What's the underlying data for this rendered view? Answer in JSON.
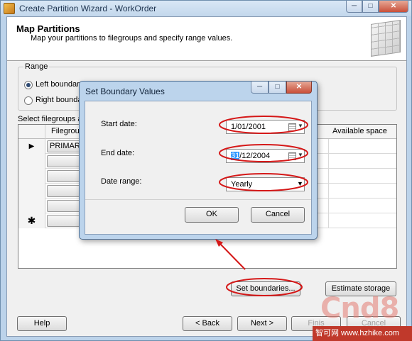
{
  "window": {
    "title": "Create Partition Wizard - WorkOrder",
    "controls": {
      "minimize": "─",
      "maximize": "□",
      "close": "✕"
    }
  },
  "header": {
    "title": "Map Partitions",
    "subtitle": "Map your partitions to filegroups and specify range values."
  },
  "range": {
    "legend": "Range",
    "left_label": "Left boundary",
    "right_label": "Right boundar",
    "selected": "left"
  },
  "grid": {
    "label": "Select filegroups ar",
    "columns": {
      "filegroup": "Filegroup",
      "available_space": "Available space"
    },
    "rows": [
      {
        "selector": "▶",
        "filegroup": "PRIMARY"
      },
      {
        "selector": "",
        "filegroup": ""
      },
      {
        "selector": "",
        "filegroup": ""
      },
      {
        "selector": "",
        "filegroup": ""
      },
      {
        "selector": "",
        "filegroup": ""
      },
      {
        "selector": "✱",
        "filegroup": ""
      }
    ]
  },
  "buttons": {
    "set_boundaries": "Set boundaries...",
    "estimate_storage": "Estimate storage",
    "help": "Help",
    "back": "< Back",
    "next": "Next >",
    "finish": "Finis",
    "cancel": "Cancel"
  },
  "dialog": {
    "title": "Set Boundary Values",
    "start_date_label": "Start date:",
    "start_date_value": "1/01/2001",
    "end_date_label": "End date:",
    "end_date_selected": "31",
    "end_date_rest": "/12/2004",
    "date_range_label": "Date range:",
    "date_range_value": "Yearly",
    "ok": "OK",
    "cancel": "Cancel",
    "controls": {
      "minimize": "─",
      "maximize": "□",
      "close": "✕"
    }
  },
  "annotation_color": "#d51818",
  "watermark": {
    "logo": "Cnd8",
    "site": "智可网 www.hzhike.com"
  },
  "icons": {
    "app": "wizard-icon",
    "calendar": "calendar-icon",
    "dropdown": "chevron-down-icon",
    "current_row": "row-pointer-icon",
    "new_row": "new-row-icon"
  }
}
